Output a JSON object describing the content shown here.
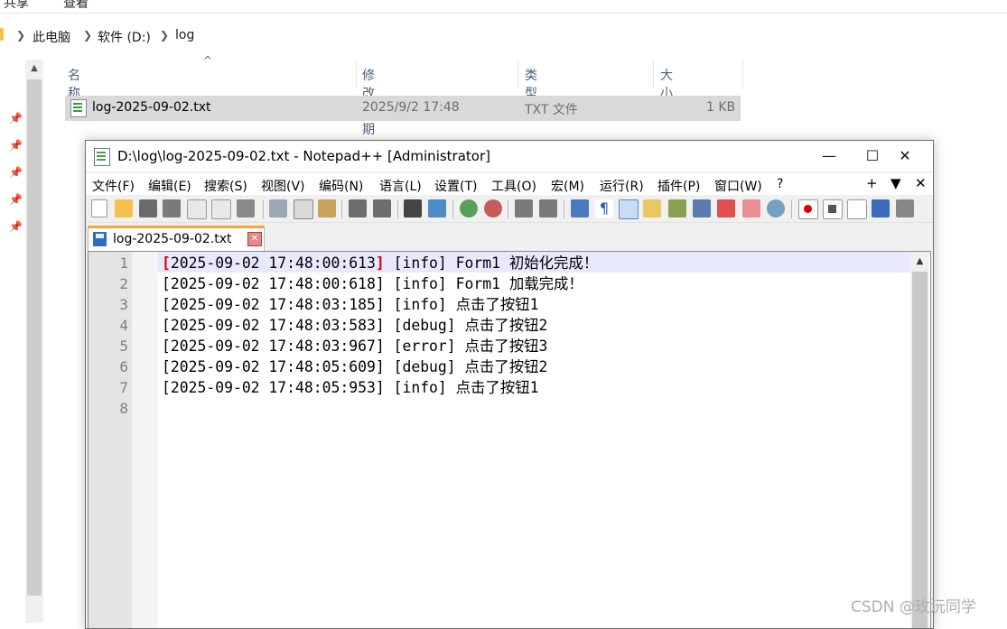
{
  "explorer": {
    "ribbon_tabs": [
      "共享",
      "查看"
    ],
    "breadcrumb": [
      "此电脑",
      "软件 (D:)",
      "log"
    ],
    "columns": [
      "名称",
      "修改日期",
      "类型",
      "大小"
    ],
    "file": {
      "name": "log-2025-09-02.txt",
      "modified": "2025/9/2 17:48",
      "type": "TXT 文件",
      "size": "1 KB"
    }
  },
  "npp": {
    "title": "D:\\log\\log-2025-09-02.txt - Notepad++ [Administrator]",
    "window_buttons": {
      "minimize": "—",
      "maximize": "☐",
      "close": "✕"
    },
    "menu": [
      "文件(F)",
      "编辑(E)",
      "搜索(S)",
      "视图(V)",
      "编码(N)",
      "语言(L)",
      "设置(T)",
      "工具(O)",
      "宏(M)",
      "运行(R)",
      "插件(P)",
      "窗口(W)",
      "?"
    ],
    "menu_right": [
      "+",
      "▼",
      "✕"
    ],
    "tab_label": "log-2025-09-02.txt",
    "tab_close": "✕",
    "line_numbers": [
      "1",
      "2",
      "3",
      "4",
      "5",
      "6",
      "7",
      "8"
    ],
    "lines": [
      {
        "open": "[",
        "ts": "2025-09-02 17:48:00:613",
        "close": "]",
        "rest": " [info] Form1 初始化完成！"
      },
      {
        "open": "[",
        "ts": "2025-09-02 17:48:00:618",
        "close": "]",
        "rest": " [info] Form1 加载完成！"
      },
      {
        "open": "[",
        "ts": "2025-09-02 17:48:03:185",
        "close": "]",
        "rest": " [info] 点击了按钮1"
      },
      {
        "open": "[",
        "ts": "2025-09-02 17:48:03:583",
        "close": "]",
        "rest": " [debug] 点击了按钮2"
      },
      {
        "open": "[",
        "ts": "2025-09-02 17:48:03:967",
        "close": "]",
        "rest": " [error] 点击了按钮3"
      },
      {
        "open": "[",
        "ts": "2025-09-02 17:48:05:609",
        "close": "]",
        "rest": " [debug] 点击了按钮2"
      },
      {
        "open": "[",
        "ts": "2025-09-02 17:48:05:953",
        "close": "]",
        "rest": " [info] 点击了按钮1"
      }
    ]
  },
  "watermark": "CSDN @玫沅同学",
  "colors": {
    "brace_match": "#e00000",
    "current_line": "#e8e8ff",
    "tab_accent": "#f6a638",
    "selected_row": "#d9d9d9"
  }
}
